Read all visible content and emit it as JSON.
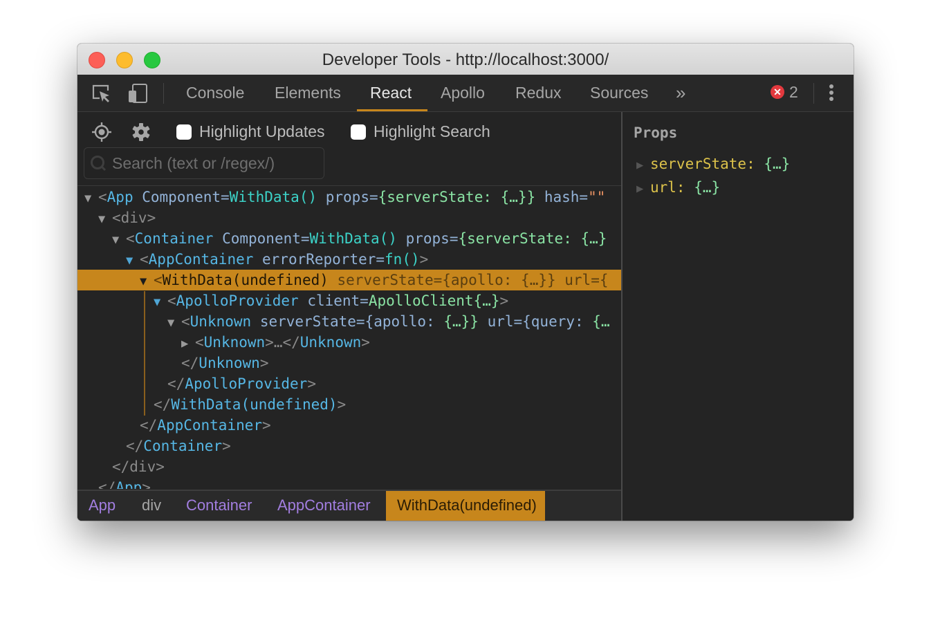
{
  "window": {
    "title": "Developer Tools - http://localhost:3000/"
  },
  "toolbar": {
    "tabs": [
      {
        "label": "Console",
        "active": false
      },
      {
        "label": "Elements",
        "active": false
      },
      {
        "label": "React",
        "active": true
      },
      {
        "label": "Apollo",
        "active": false
      },
      {
        "label": "Redux",
        "active": false
      },
      {
        "label": "Sources",
        "active": false
      }
    ],
    "overflow_label": "»",
    "error_count": "2",
    "error_icon": "✕"
  },
  "controls": {
    "highlight_updates_label": "Highlight Updates",
    "highlight_updates_checked": false,
    "highlight_search_label": "Highlight Search",
    "highlight_search_checked": false,
    "search_placeholder": "Search (text or /regex/)",
    "search_value": ""
  },
  "tree": {
    "rows": [
      {
        "arrow": "▼",
        "open": "<",
        "tag": "App",
        "rest": [
          " Component=",
          "WithData()",
          " props=",
          "{serverState: ",
          "{…}}",
          " hash=",
          "\"\""
        ]
      },
      {
        "arrow": "▼",
        "text": "<div>"
      },
      {
        "arrow": "▼",
        "open": "<",
        "tag": "Container",
        "rest": [
          " Component=",
          "WithData()",
          " props=",
          "{serverState: ",
          "{…}"
        ]
      },
      {
        "arrow": "▼",
        "open": "<",
        "tag": "AppContainer",
        "rest": [
          " errorReporter=",
          "fn()",
          ">"
        ]
      },
      {
        "arrow": "▼",
        "open": "<",
        "tag": "WithData(undefined)",
        "rest": [
          " serverState=",
          "{apollo: ",
          "{…}}",
          " url=",
          "{"
        ],
        "selected": true
      },
      {
        "arrow": "▼",
        "open": "<",
        "tag": "ApolloProvider",
        "rest": [
          " client=",
          "ApolloClient{…}",
          ">"
        ]
      },
      {
        "arrow": "▼",
        "open": "<",
        "tag": "Unknown",
        "rest": [
          " serverState=",
          "{apollo: ",
          "{…}}",
          " url=",
          "{query: ",
          "{…"
        ]
      },
      {
        "arrow": "▶",
        "open": "<",
        "tag": "Unknown",
        "rest": [
          ">…</",
          "Unknown",
          ">"
        ]
      },
      {
        "close_open": "</",
        "tag": "Unknown",
        "close": ">"
      },
      {
        "close_open": "</",
        "tag": "ApolloProvider",
        "close": ">"
      },
      {
        "close_open": "</",
        "tag": "WithData(undefined)",
        "close": ">"
      },
      {
        "close_open": "</",
        "tag": "AppContainer",
        "close": ">"
      },
      {
        "close_open": "</",
        "tag": "Container",
        "close": ">"
      },
      {
        "text": "</div>"
      },
      {
        "close_open": "</",
        "tag": "App",
        "close": ">"
      }
    ]
  },
  "breadcrumbs": [
    {
      "label": "App"
    },
    {
      "label": "div"
    },
    {
      "label": "Container"
    },
    {
      "label": "AppContainer"
    },
    {
      "label": "WithData(undefined)",
      "active": true
    }
  ],
  "props_panel": {
    "title": "Props",
    "items": [
      {
        "key": "serverState:",
        "value": "{…}"
      },
      {
        "key": "url:",
        "value": "{…}"
      }
    ]
  },
  "colors": {
    "accent": "#c7861c",
    "tag_name": "#56b7e5",
    "attr_name": "#93b3d8",
    "function_value": "#3cd3c8",
    "object_value": "#8ae3a4",
    "string_value": "#e99263",
    "prop_key": "#dcc24a",
    "breadcrumb": "#a27ee0",
    "error": "#e3393e"
  }
}
